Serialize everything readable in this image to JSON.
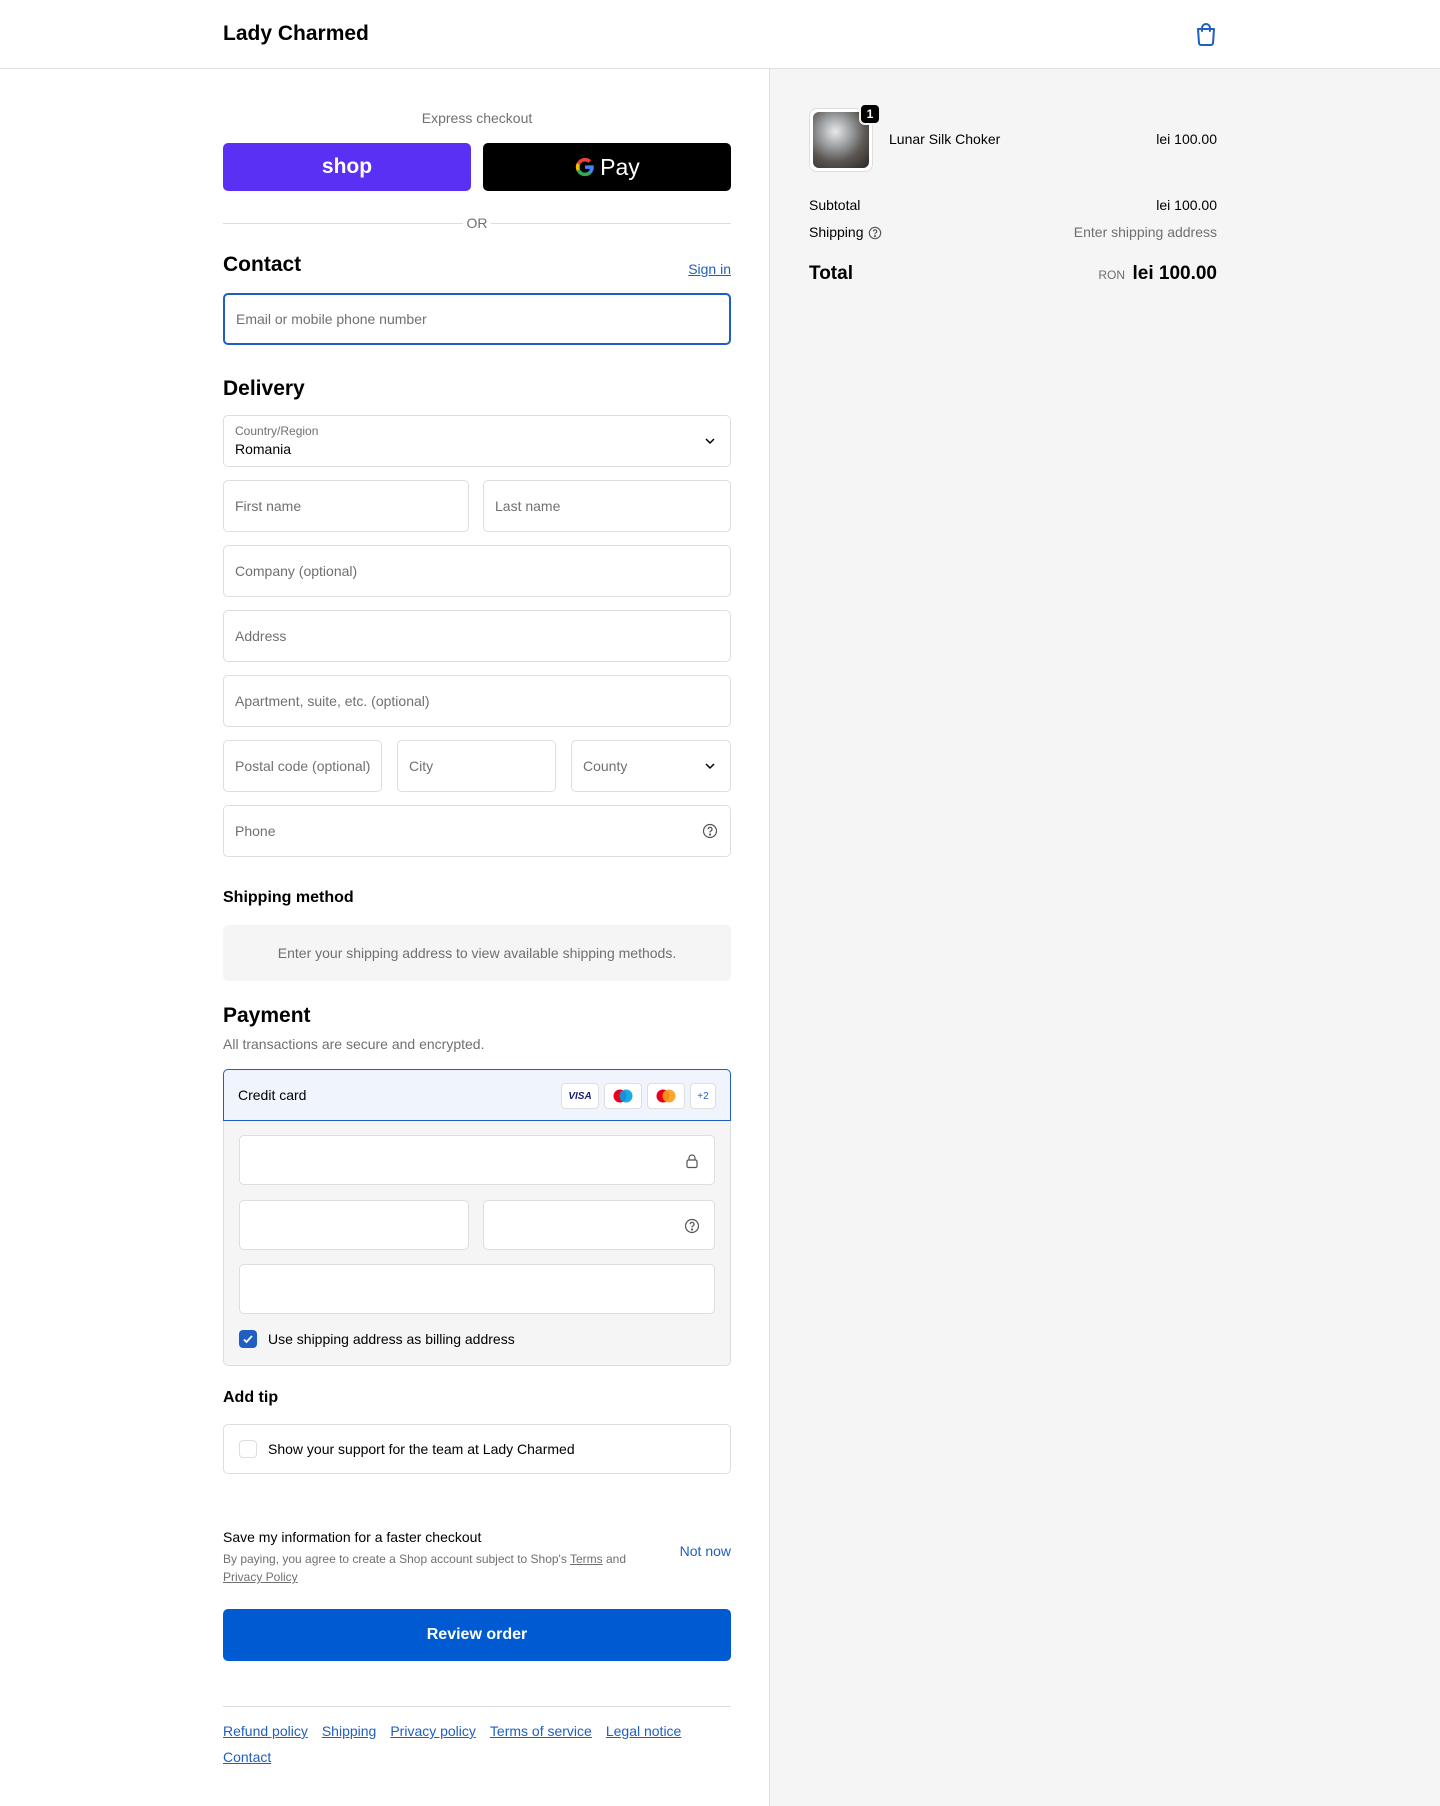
{
  "header": {
    "shop_name": "Lady Charmed",
    "cart_icon": "shopping-bag-icon"
  },
  "express": {
    "label": "Express checkout",
    "shop_pay_label": "shop",
    "gpay_label": "Pay",
    "or_label": "OR",
    "shop_pay_color": "#5a31f4",
    "gpay_color": "#000000"
  },
  "contact": {
    "title": "Contact",
    "sign_in": "Sign in",
    "email_placeholder": "Email or mobile phone number"
  },
  "delivery": {
    "title": "Delivery",
    "country_label": "Country/Region",
    "country_value": "Romania",
    "first_name": "First name",
    "last_name": "Last name",
    "company": "Company (optional)",
    "address": "Address",
    "apartment": "Apartment, suite, etc. (optional)",
    "postal": "Postal code (optional)",
    "city": "City",
    "county": "County",
    "phone": "Phone"
  },
  "shipping_method": {
    "title": "Shipping method",
    "message": "Enter your shipping address to view available shipping methods."
  },
  "payment": {
    "title": "Payment",
    "subtitle": "All transactions are secure and encrypted.",
    "method": "Credit card",
    "cards": [
      "VISA",
      "maestro",
      "mastercard"
    ],
    "more_cards": "+2",
    "billing_same": "Use shipping address as billing address",
    "billing_same_checked": true
  },
  "tip": {
    "title": "Add tip",
    "option": "Show your support for the team at Lady Charmed",
    "checked": false
  },
  "save_info": {
    "title": "Save my information for a faster checkout",
    "desc_prefix": "By paying, you agree to create a Shop account subject to Shop's ",
    "terms": "Terms",
    "and": " and ",
    "privacy": "Privacy Policy",
    "not_now": "Not now"
  },
  "review_button": "Review order",
  "footer_links": [
    "Refund policy",
    "Shipping",
    "Privacy policy",
    "Terms of service",
    "Legal notice",
    "Contact"
  ],
  "summary": {
    "product_name": "Lunar Silk Choker",
    "product_price": "lei 100.00",
    "quantity": "1",
    "subtotal_label": "Subtotal",
    "subtotal_value": "lei 100.00",
    "shipping_label": "Shipping",
    "shipping_value": "Enter shipping address",
    "total_label": "Total",
    "currency": "RON",
    "total_value": "lei 100.00"
  },
  "colors": {
    "accent": "#1f5fc1",
    "primary_button": "#005bd3",
    "summary_bg": "#f5f5f5"
  }
}
